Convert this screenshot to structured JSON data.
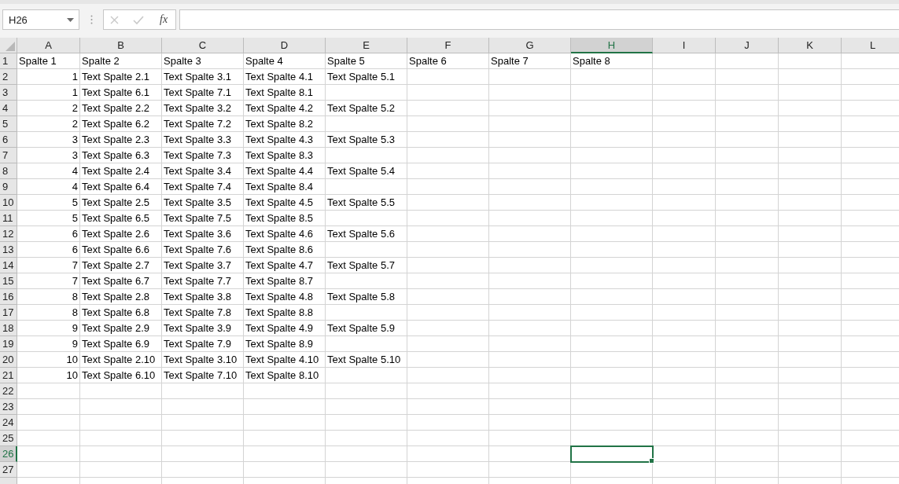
{
  "formula_bar": {
    "name_box": "H26",
    "function_label": "fx",
    "cancel_disabled": true,
    "confirm_disabled": true
  },
  "columns": [
    {
      "label": "A",
      "selected": false
    },
    {
      "label": "B",
      "selected": false
    },
    {
      "label": "C",
      "selected": false
    },
    {
      "label": "D",
      "selected": false
    },
    {
      "label": "E",
      "selected": false
    },
    {
      "label": "F",
      "selected": false
    },
    {
      "label": "G",
      "selected": false
    },
    {
      "label": "H",
      "selected": true
    },
    {
      "label": "I",
      "selected": false
    },
    {
      "label": "J",
      "selected": false
    },
    {
      "label": "K",
      "selected": false
    },
    {
      "label": "L",
      "selected": false
    }
  ],
  "rows": [
    {
      "number": "1",
      "selected": false,
      "cells": [
        {
          "kind": "text",
          "value": "Spalte 1"
        },
        {
          "kind": "text",
          "value": "Spalte 2"
        },
        {
          "kind": "text",
          "value": "Spalte 3"
        },
        {
          "kind": "text",
          "value": "Spalte 4"
        },
        {
          "kind": "text",
          "value": "Spalte 5"
        },
        {
          "kind": "text",
          "value": "Spalte 6"
        },
        {
          "kind": "text",
          "value": "Spalte 7"
        },
        {
          "kind": "text",
          "value": "Spalte 8"
        }
      ]
    },
    {
      "number": "2",
      "selected": false,
      "cells": [
        {
          "kind": "number",
          "value": "1"
        },
        {
          "kind": "text",
          "value": "Text Spalte 2.1"
        },
        {
          "kind": "text",
          "value": "Text Spalte 3.1"
        },
        {
          "kind": "text",
          "value": "Text Spalte 4.1"
        },
        {
          "kind": "text",
          "value": "Text Spalte 5.1"
        }
      ]
    },
    {
      "number": "3",
      "selected": false,
      "cells": [
        {
          "kind": "number",
          "value": "1"
        },
        {
          "kind": "text",
          "value": "Text Spalte 6.1"
        },
        {
          "kind": "text",
          "value": "Text Spalte 7.1"
        },
        {
          "kind": "text",
          "value": "Text Spalte 8.1"
        }
      ]
    },
    {
      "number": "4",
      "selected": false,
      "cells": [
        {
          "kind": "number",
          "value": "2"
        },
        {
          "kind": "text",
          "value": "Text Spalte 2.2"
        },
        {
          "kind": "text",
          "value": "Text Spalte 3.2"
        },
        {
          "kind": "text",
          "value": "Text Spalte 4.2"
        },
        {
          "kind": "text",
          "value": "Text Spalte 5.2"
        }
      ]
    },
    {
      "number": "5",
      "selected": false,
      "cells": [
        {
          "kind": "number",
          "value": "2"
        },
        {
          "kind": "text",
          "value": "Text Spalte 6.2"
        },
        {
          "kind": "text",
          "value": "Text Spalte 7.2"
        },
        {
          "kind": "text",
          "value": "Text Spalte 8.2"
        }
      ]
    },
    {
      "number": "6",
      "selected": false,
      "cells": [
        {
          "kind": "number",
          "value": "3"
        },
        {
          "kind": "text",
          "value": "Text Spalte 2.3"
        },
        {
          "kind": "text",
          "value": "Text Spalte 3.3"
        },
        {
          "kind": "text",
          "value": "Text Spalte 4.3"
        },
        {
          "kind": "text",
          "value": "Text Spalte 5.3"
        }
      ]
    },
    {
      "number": "7",
      "selected": false,
      "cells": [
        {
          "kind": "number",
          "value": "3"
        },
        {
          "kind": "text",
          "value": "Text Spalte 6.3"
        },
        {
          "kind": "text",
          "value": "Text Spalte 7.3"
        },
        {
          "kind": "text",
          "value": "Text Spalte 8.3"
        }
      ]
    },
    {
      "number": "8",
      "selected": false,
      "cells": [
        {
          "kind": "number",
          "value": "4"
        },
        {
          "kind": "text",
          "value": "Text Spalte 2.4"
        },
        {
          "kind": "text",
          "value": "Text Spalte 3.4"
        },
        {
          "kind": "text",
          "value": "Text Spalte 4.4"
        },
        {
          "kind": "text",
          "value": "Text Spalte 5.4"
        }
      ]
    },
    {
      "number": "9",
      "selected": false,
      "cells": [
        {
          "kind": "number",
          "value": "4"
        },
        {
          "kind": "text",
          "value": "Text Spalte 6.4"
        },
        {
          "kind": "text",
          "value": "Text Spalte 7.4"
        },
        {
          "kind": "text",
          "value": "Text Spalte 8.4"
        }
      ]
    },
    {
      "number": "10",
      "selected": false,
      "cells": [
        {
          "kind": "number",
          "value": "5"
        },
        {
          "kind": "text",
          "value": "Text Spalte 2.5"
        },
        {
          "kind": "text",
          "value": "Text Spalte 3.5"
        },
        {
          "kind": "text",
          "value": "Text Spalte 4.5"
        },
        {
          "kind": "text",
          "value": "Text Spalte 5.5"
        }
      ]
    },
    {
      "number": "11",
      "selected": false,
      "cells": [
        {
          "kind": "number",
          "value": "5"
        },
        {
          "kind": "text",
          "value": "Text Spalte 6.5"
        },
        {
          "kind": "text",
          "value": "Text Spalte 7.5"
        },
        {
          "kind": "text",
          "value": "Text Spalte 8.5"
        }
      ]
    },
    {
      "number": "12",
      "selected": false,
      "cells": [
        {
          "kind": "number",
          "value": "6"
        },
        {
          "kind": "text",
          "value": "Text Spalte 2.6"
        },
        {
          "kind": "text",
          "value": "Text Spalte 3.6"
        },
        {
          "kind": "text",
          "value": "Text Spalte 4.6"
        },
        {
          "kind": "text",
          "value": "Text Spalte 5.6"
        }
      ]
    },
    {
      "number": "13",
      "selected": false,
      "cells": [
        {
          "kind": "number",
          "value": "6"
        },
        {
          "kind": "text",
          "value": "Text Spalte 6.6"
        },
        {
          "kind": "text",
          "value": "Text Spalte 7.6"
        },
        {
          "kind": "text",
          "value": "Text Spalte 8.6"
        }
      ]
    },
    {
      "number": "14",
      "selected": false,
      "cells": [
        {
          "kind": "number",
          "value": "7"
        },
        {
          "kind": "text",
          "value": "Text Spalte 2.7"
        },
        {
          "kind": "text",
          "value": "Text Spalte 3.7"
        },
        {
          "kind": "text",
          "value": "Text Spalte 4.7"
        },
        {
          "kind": "text",
          "value": "Text Spalte 5.7"
        }
      ]
    },
    {
      "number": "15",
      "selected": false,
      "cells": [
        {
          "kind": "number",
          "value": "7"
        },
        {
          "kind": "text",
          "value": "Text Spalte 6.7"
        },
        {
          "kind": "text",
          "value": "Text Spalte 7.7"
        },
        {
          "kind": "text",
          "value": "Text Spalte 8.7"
        }
      ]
    },
    {
      "number": "16",
      "selected": false,
      "cells": [
        {
          "kind": "number",
          "value": "8"
        },
        {
          "kind": "text",
          "value": "Text Spalte 2.8"
        },
        {
          "kind": "text",
          "value": "Text Spalte 3.8"
        },
        {
          "kind": "text",
          "value": "Text Spalte 4.8"
        },
        {
          "kind": "text",
          "value": "Text Spalte 5.8"
        }
      ]
    },
    {
      "number": "17",
      "selected": false,
      "cells": [
        {
          "kind": "number",
          "value": "8"
        },
        {
          "kind": "text",
          "value": "Text Spalte 6.8"
        },
        {
          "kind": "text",
          "value": "Text Spalte 7.8"
        },
        {
          "kind": "text",
          "value": "Text Spalte 8.8"
        }
      ]
    },
    {
      "number": "18",
      "selected": false,
      "cells": [
        {
          "kind": "number",
          "value": "9"
        },
        {
          "kind": "text",
          "value": "Text Spalte 2.9"
        },
        {
          "kind": "text",
          "value": "Text Spalte 3.9"
        },
        {
          "kind": "text",
          "value": "Text Spalte 4.9"
        },
        {
          "kind": "text",
          "value": "Text Spalte 5.9"
        }
      ]
    },
    {
      "number": "19",
      "selected": false,
      "cells": [
        {
          "kind": "number",
          "value": "9"
        },
        {
          "kind": "text",
          "value": "Text Spalte 6.9"
        },
        {
          "kind": "text",
          "value": "Text Spalte 7.9"
        },
        {
          "kind": "text",
          "value": "Text Spalte 8.9"
        }
      ]
    },
    {
      "number": "20",
      "selected": false,
      "cells": [
        {
          "kind": "number",
          "value": "10"
        },
        {
          "kind": "text",
          "value": "Text Spalte 2.10"
        },
        {
          "kind": "text",
          "value": "Text Spalte 3.10"
        },
        {
          "kind": "text",
          "value": "Text Spalte 4.10"
        },
        {
          "kind": "text",
          "value": "Text Spalte 5.10"
        }
      ]
    },
    {
      "number": "21",
      "selected": false,
      "cells": [
        {
          "kind": "number",
          "value": "10"
        },
        {
          "kind": "text",
          "value": "Text Spalte 6.10"
        },
        {
          "kind": "text",
          "value": "Text Spalte 7.10"
        },
        {
          "kind": "text",
          "value": "Text Spalte 8.10"
        }
      ]
    },
    {
      "number": "22",
      "selected": false
    },
    {
      "number": "23",
      "selected": false
    },
    {
      "number": "24",
      "selected": false
    },
    {
      "number": "25",
      "selected": false
    },
    {
      "number": "26",
      "selected": true
    },
    {
      "number": "27",
      "selected": false
    }
  ]
}
